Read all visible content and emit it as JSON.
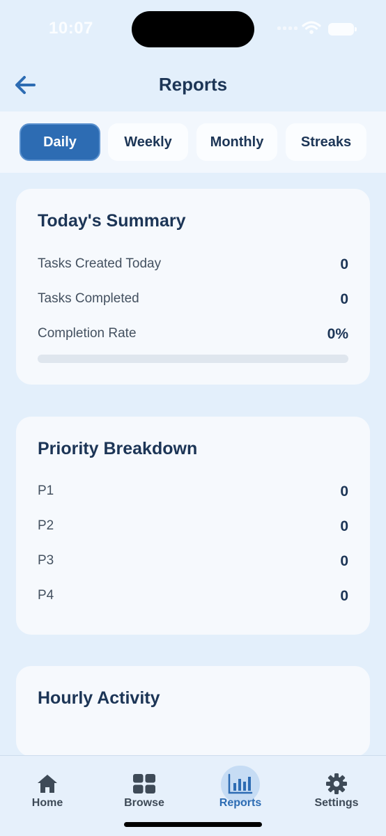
{
  "status_bar": {
    "time": "10:07"
  },
  "header": {
    "title": "Reports",
    "back_icon": "arrow-left-icon"
  },
  "tabs": [
    {
      "label": "Daily",
      "active": true
    },
    {
      "label": "Weekly",
      "active": false
    },
    {
      "label": "Monthly",
      "active": false
    },
    {
      "label": "Streaks",
      "active": false
    }
  ],
  "summary": {
    "title": "Today's Summary",
    "rows": [
      {
        "label": "Tasks Created Today",
        "value": "0"
      },
      {
        "label": "Tasks Completed",
        "value": "0"
      },
      {
        "label": "Completion Rate",
        "value": "0%"
      }
    ],
    "completion_progress": 0
  },
  "priority": {
    "title": "Priority Breakdown",
    "rows": [
      {
        "label": "P1",
        "value": "0"
      },
      {
        "label": "P2",
        "value": "0"
      },
      {
        "label": "P3",
        "value": "0"
      },
      {
        "label": "P4",
        "value": "0"
      }
    ]
  },
  "hourly": {
    "title": "Hourly Activity"
  },
  "bottom_nav": [
    {
      "label": "Home",
      "icon": "home-icon",
      "active": false
    },
    {
      "label": "Browse",
      "icon": "grid-icon",
      "active": false
    },
    {
      "label": "Reports",
      "icon": "bar-chart-icon",
      "active": true
    },
    {
      "label": "Settings",
      "icon": "gear-icon",
      "active": false
    }
  ],
  "colors": {
    "accent": "#2d6cb3",
    "background": "#e3effb",
    "card": "#f6f9fd",
    "text": "#1c3556"
  }
}
